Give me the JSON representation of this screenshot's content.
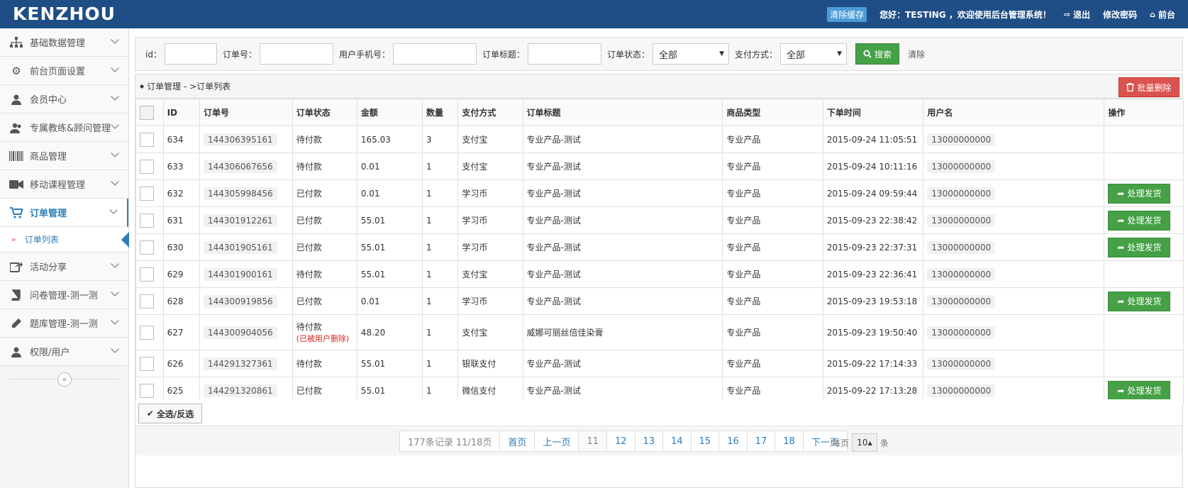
{
  "header": {
    "logo": "KENZHOU",
    "clear_cache": "清除缓存",
    "greeting": "您好：TESTING ，欢迎使用后台管理系统！",
    "logout": "退出",
    "change_password": "修改密码",
    "frontend": "前台"
  },
  "sidebar": {
    "items": [
      {
        "label": "基础数据管理",
        "icon": "sitemap-icon"
      },
      {
        "label": "前台页面设置",
        "icon": "gears-icon"
      },
      {
        "label": "会员中心",
        "icon": "user-icon"
      },
      {
        "label": "专属教练&顾问管理",
        "icon": "users-icon"
      },
      {
        "label": "商品管理",
        "icon": "barcode-icon"
      },
      {
        "label": "移动课程管理",
        "icon": "video-camera-icon"
      },
      {
        "label": "订单管理",
        "icon": "shopping-cart-icon"
      },
      {
        "label": "活动分享",
        "icon": "share-icon"
      },
      {
        "label": "问卷管理-测一测",
        "icon": "book-icon"
      },
      {
        "label": "题库管理-测一测",
        "icon": "pencil-icon"
      },
      {
        "label": "权限/用户",
        "icon": "user-icon"
      }
    ],
    "sub_item": "订单列表"
  },
  "search": {
    "id_label": "id：",
    "order_no_label": "订单号：",
    "phone_label": "用户手机号：",
    "title_label": "订单标题：",
    "status_label": "订单状态：",
    "status_value": "全部",
    "pay_label": "支付方式：",
    "pay_value": "全部",
    "search_button": "搜索",
    "clear_button": "清除"
  },
  "panel": {
    "breadcrumb": "订单管理 - >订单列表",
    "batch_delete": "批量删除"
  },
  "table": {
    "headers": [
      "ID",
      "订单号",
      "订单状态",
      "金额",
      "数量",
      "支付方式",
      "订单标题",
      "商品类型",
      "下单时间",
      "用户名",
      "操作"
    ],
    "rows": [
      {
        "id": "634",
        "order_no": "144306395161",
        "status": "待付款",
        "status_note": "",
        "amount": "165.03",
        "qty": "3",
        "pay": "支付宝",
        "title": "专业产品-测试",
        "type": "专业产品",
        "time": "2015-09-24 11:05:51",
        "user": "13000000000",
        "action": ""
      },
      {
        "id": "633",
        "order_no": "144306067656",
        "status": "待付款",
        "status_note": "",
        "amount": "0.01",
        "qty": "1",
        "pay": "支付宝",
        "title": "专业产品-测试",
        "type": "专业产品",
        "time": "2015-09-24 10:11:16",
        "user": "13000000000",
        "action": ""
      },
      {
        "id": "632",
        "order_no": "144305998456",
        "status": "已付款",
        "status_note": "",
        "amount": "0.01",
        "qty": "1",
        "pay": "学习币",
        "title": "专业产品-测试",
        "type": "专业产品",
        "time": "2015-09-24 09:59:44",
        "user": "13000000000",
        "action": "处理发货"
      },
      {
        "id": "631",
        "order_no": "144301912261",
        "status": "已付款",
        "status_note": "",
        "amount": "55.01",
        "qty": "1",
        "pay": "学习币",
        "title": "专业产品-测试",
        "type": "专业产品",
        "time": "2015-09-23 22:38:42",
        "user": "13000000000",
        "action": "处理发货"
      },
      {
        "id": "630",
        "order_no": "144301905161",
        "status": "已付款",
        "status_note": "",
        "amount": "55.01",
        "qty": "1",
        "pay": "学习币",
        "title": "专业产品-测试",
        "type": "专业产品",
        "time": "2015-09-23 22:37:31",
        "user": "13000000000",
        "action": "处理发货"
      },
      {
        "id": "629",
        "order_no": "144301900161",
        "status": "待付款",
        "status_note": "",
        "amount": "55.01",
        "qty": "1",
        "pay": "支付宝",
        "title": "专业产品-测试",
        "type": "专业产品",
        "time": "2015-09-23 22:36:41",
        "user": "13000000000",
        "action": ""
      },
      {
        "id": "628",
        "order_no": "144300919856",
        "status": "已付款",
        "status_note": "",
        "amount": "0.01",
        "qty": "1",
        "pay": "学习币",
        "title": "专业产品-测试",
        "type": "专业产品",
        "time": "2015-09-23 19:53:18",
        "user": "13000000000",
        "action": "处理发货"
      },
      {
        "id": "627",
        "order_no": "144300904056",
        "status": "待付款",
        "status_note": "(已被用户删除)",
        "amount": "48.20",
        "qty": "1",
        "pay": "支付宝",
        "title": "威娜可丽丝倍佳染膏",
        "type": "专业产品",
        "time": "2015-09-23 19:50:40",
        "user": "13000000000",
        "action": ""
      },
      {
        "id": "626",
        "order_no": "144291327361",
        "status": "待付款",
        "status_note": "",
        "amount": "55.01",
        "qty": "1",
        "pay": "银联支付",
        "title": "专业产品-测试",
        "type": "专业产品",
        "time": "2015-09-22 17:14:33",
        "user": "13000000000",
        "action": ""
      },
      {
        "id": "625",
        "order_no": "144291320861",
        "status": "已付款",
        "status_note": "",
        "amount": "55.01",
        "qty": "1",
        "pay": "微信支付",
        "title": "专业产品-测试",
        "type": "专业产品",
        "time": "2015-09-22 17:13:28",
        "user": "13000000000",
        "action": "处理发货"
      }
    ]
  },
  "select_all": "全选/反选",
  "pagination": {
    "info": "177条记录 11/18页",
    "first": "首页",
    "prev": "上一页",
    "pages": [
      "11",
      "12",
      "13",
      "14",
      "15",
      "16",
      "17",
      "18"
    ],
    "current": "11",
    "next": "下一页",
    "per_page_label": "每页",
    "per_page_value": "10",
    "per_page_unit": "条"
  },
  "colors": {
    "navbar": "#1f4e86",
    "accent": "#2b7dbc",
    "success": "#45a046",
    "danger": "#d9534f"
  }
}
